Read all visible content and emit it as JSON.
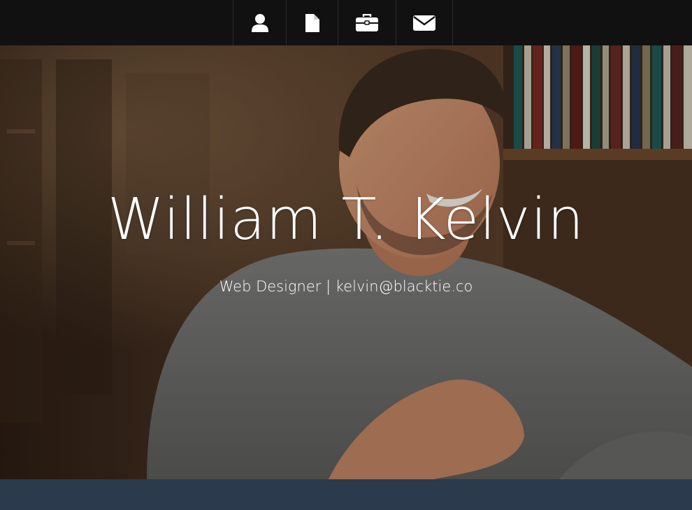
{
  "navbar": {
    "items": [
      {
        "icon": "user-icon"
      },
      {
        "icon": "document-icon"
      },
      {
        "icon": "briefcase-icon"
      },
      {
        "icon": "envelope-icon"
      }
    ]
  },
  "hero": {
    "title": "William T. Kelvin",
    "subtitle": "Web Designer | kelvin@blacktie.co"
  },
  "colors": {
    "navbar_bg": "#111111",
    "section_bg": "#2b3a4c",
    "text": "#ffffff"
  }
}
